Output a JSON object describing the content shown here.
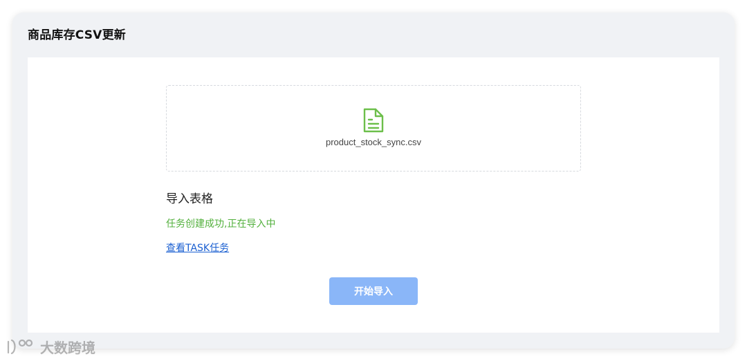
{
  "card": {
    "title": "商品库存CSV更新"
  },
  "upload": {
    "file_icon": "file-text-icon",
    "file_name": "product_stock_sync.csv"
  },
  "section": {
    "title": "导入表格",
    "status": "任务创建成功,正在导入中",
    "task_link": "查看TASK任务"
  },
  "actions": {
    "start_label": "开始导入"
  },
  "watermark": {
    "text": "大数跨境"
  },
  "colors": {
    "success": "#52b03c",
    "link": "#1a5fd1",
    "button_disabled": "#8ab6f8",
    "file_icon": "#6cbf4a"
  }
}
